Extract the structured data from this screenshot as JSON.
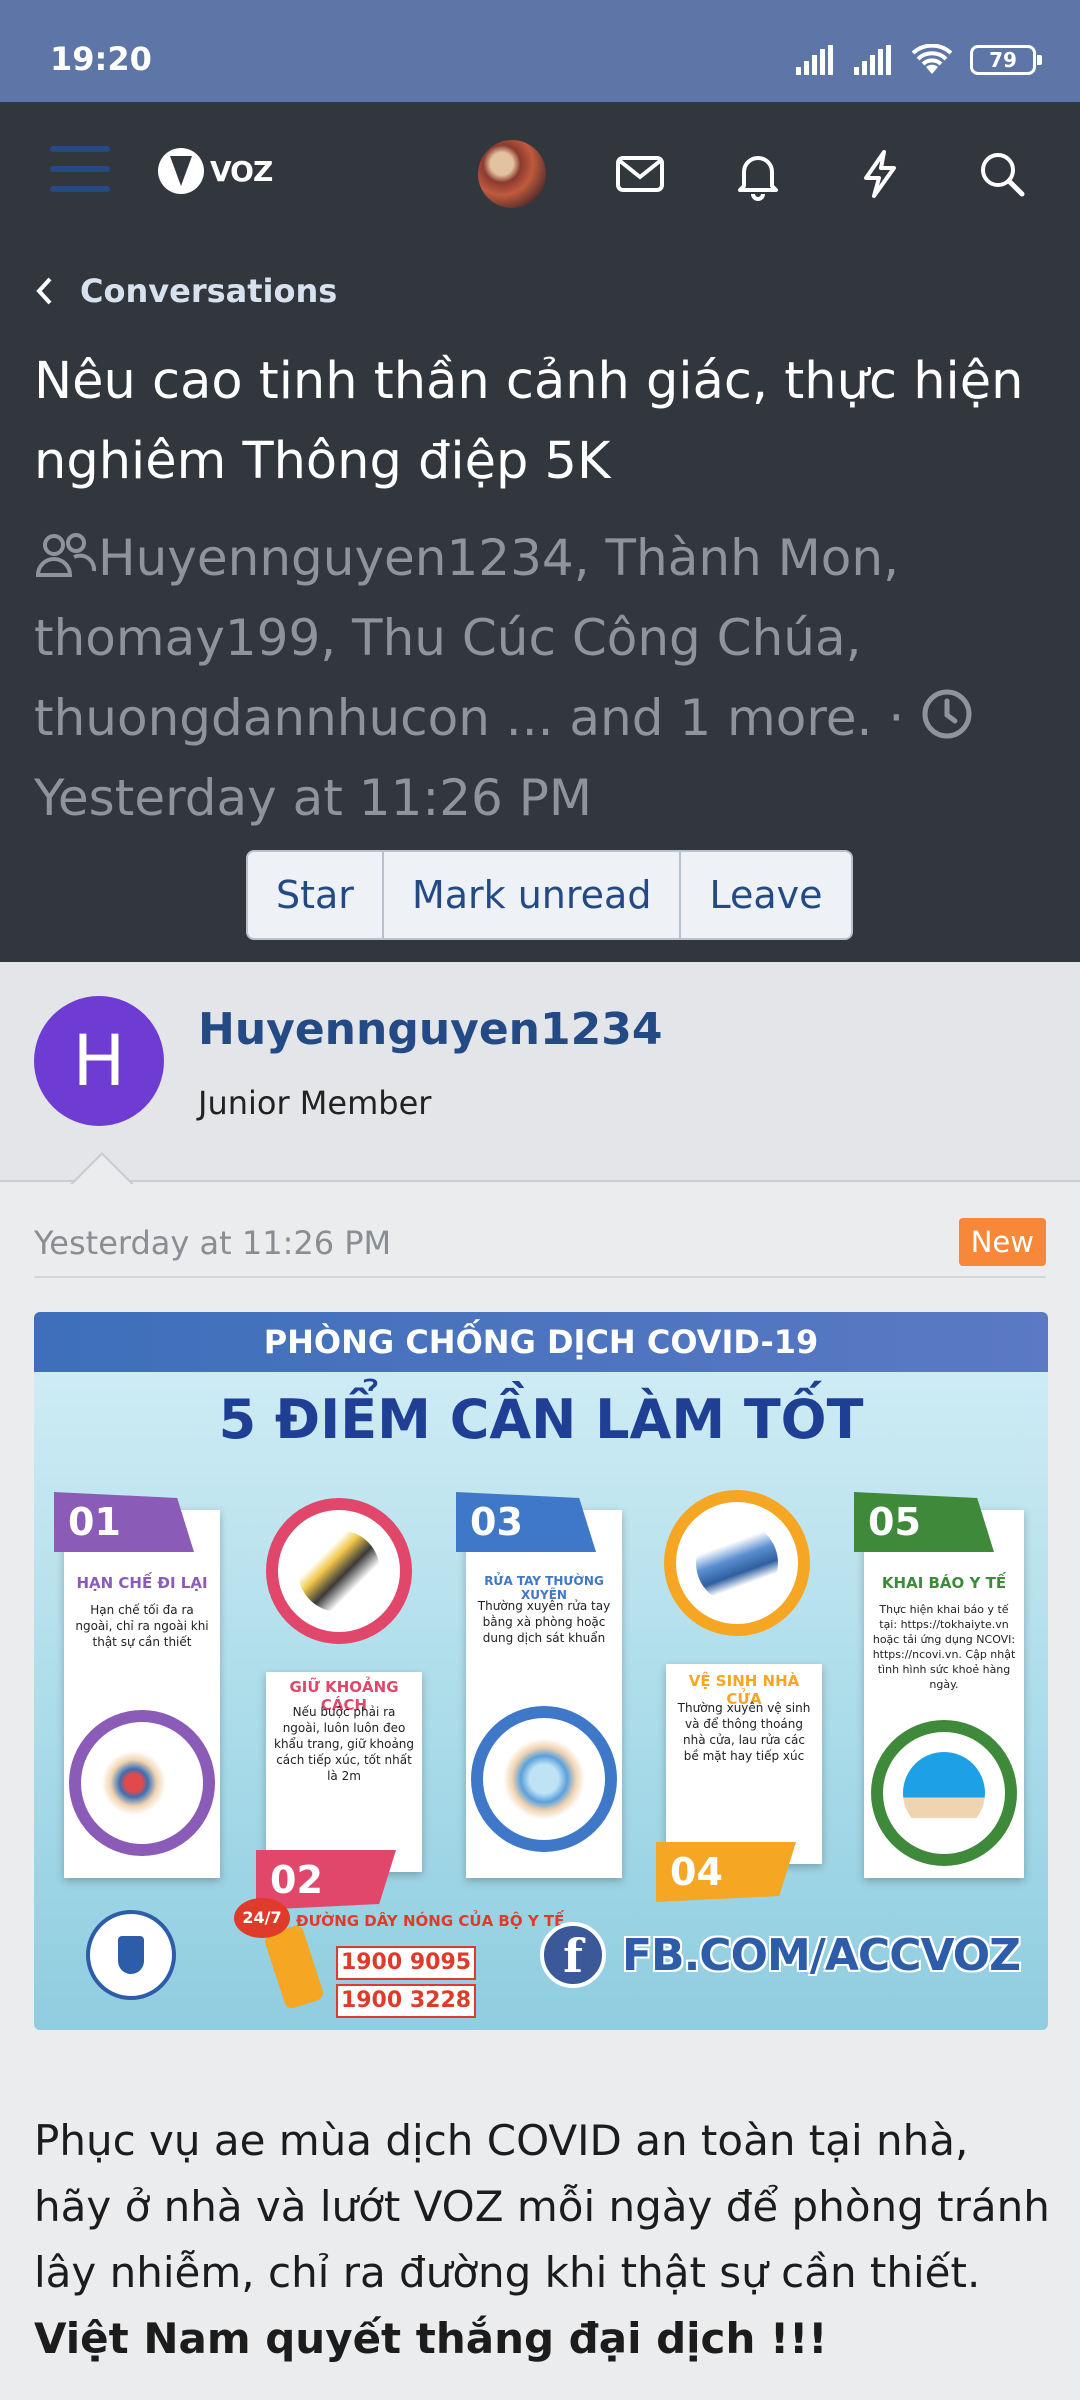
{
  "status_bar": {
    "time": "19:20",
    "battery": "79"
  },
  "nav": {
    "logo_text": "VOZ"
  },
  "header": {
    "back_label": "Conversations",
    "title": "Nêu cao tinh thần cảnh giác, thực hiện nghiêm Thông điệp 5K",
    "participants": "Huyennguyen1234, Thành Mon, thomay199, Thu Cúc Công Chúa, thuongdannhucon ... and 1 more. ·",
    "time": "Yesterday at 11:26 PM",
    "buttons": {
      "star": "Star",
      "mark_unread": "Mark unread",
      "leave": "Leave"
    }
  },
  "message": {
    "avatar_letter": "H",
    "username": "Huyennguyen1234",
    "role": "Junior Member",
    "date": "Yesterday at 11:26 PM",
    "badge": "New",
    "body_text": "Phục vụ ae mùa dịch COVID an toàn tại nhà, hãy ở nhà và lướt VOZ mỗi ngày để phòng tránh lây nhiễm, chỉ ra đường khi thật sự cần thiết. ",
    "body_bold": "Việt Nam quyết thắng đại dịch !!!"
  },
  "infographic": {
    "top_banner": "PHÒNG CHỐNG DỊCH COVID-19",
    "headline": "5 ĐIỂM CẦN LÀM TỐT",
    "cards": [
      {
        "num": "01",
        "title": "HẠN CHẾ ĐI LẠI",
        "text": "Hạn chế tối đa ra ngoài, chỉ ra ngoài khi thật sự cần thiết",
        "color": "#8b5bb8"
      },
      {
        "num": "02",
        "title": "GIỮ KHOẢNG CÁCH",
        "text": "Nếu buộc phải ra ngoài, luôn luôn đeo khẩu trang, giữ khoảng cách tiếp xúc, tốt nhất là 2m",
        "color": "#e0476a"
      },
      {
        "num": "03",
        "title": "RỬA TAY THƯỜNG XUYÊN",
        "text": "Thường xuyên rửa tay bằng xà phòng hoặc dung dịch sát khuẩn",
        "color": "#3f78c8"
      },
      {
        "num": "04",
        "title": "VỆ SINH NHÀ CỬA",
        "text": "Thường xuyên vệ sinh và để thông thoáng nhà cửa, lau rửa các bề mặt hay tiếp xúc",
        "color": "#f5a623"
      },
      {
        "num": "05",
        "title": "KHAI BÁO Y TẾ",
        "text": "Thực hiện khai báo y tế tại: https://tokhaiyte.vn hoặc tải ứng dụng NCOVI: https://ncovi.vn. Cập nhật tình hình sức khoẻ hàng ngày.",
        "color": "#3f8a3a"
      }
    ],
    "hotline_label": "ĐƯỜNG DÂY NÓNG CỦA BỘ Y TẾ",
    "hotline_badge": "24/7",
    "hotline_1": "1900 9095",
    "hotline_2": "1900 3228",
    "fb_text": "FB.COM/ACCVOZ"
  }
}
